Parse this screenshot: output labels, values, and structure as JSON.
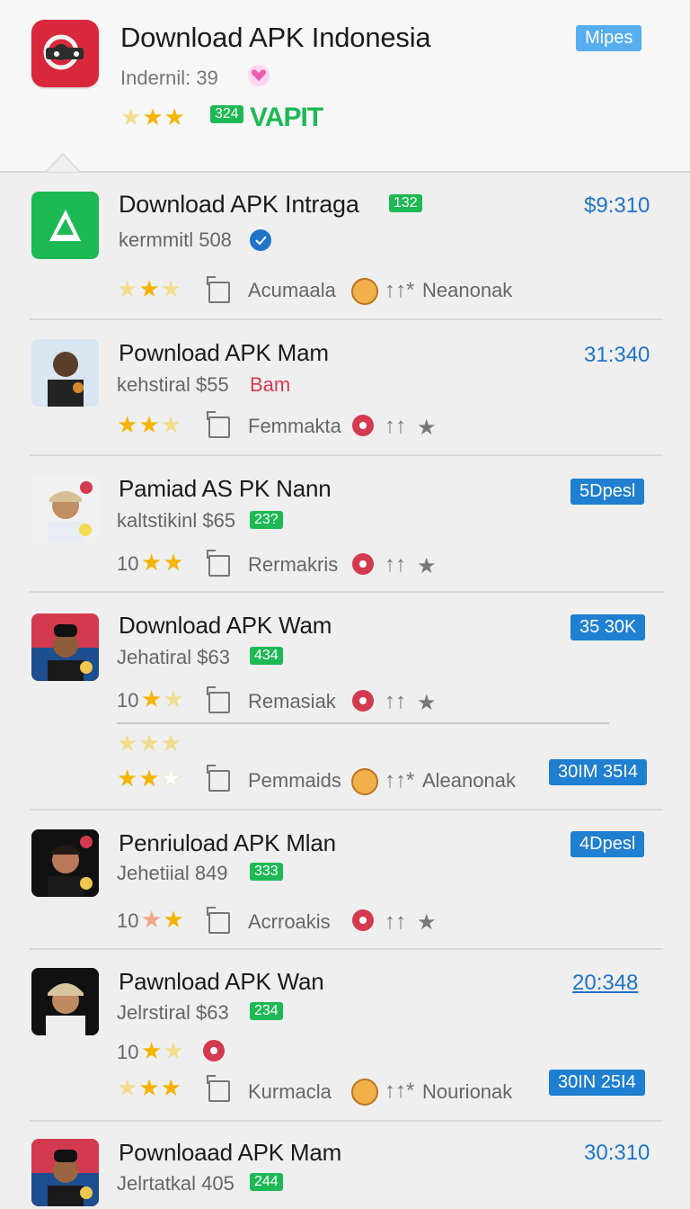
{
  "header": {
    "title": "Download APK Indonesia",
    "subtitle": "Indernil: 39",
    "button": "Mipes",
    "badge": "324",
    "tag": "VAPIT"
  },
  "items": [
    {
      "title": "Download APK Intraga",
      "title_badge": "132",
      "meta": "kermmitl 508",
      "time": "$9:310",
      "footer_left": "Acumaala",
      "footer_right": "Neanonak"
    },
    {
      "title": "Pownload APK Mam",
      "meta": "kehstiral $55",
      "meta_red": "Bam",
      "time": "31:340",
      "footer_left": "Femmakta"
    },
    {
      "title": "Pamiad AS PK Nann",
      "meta": "kaltstikinl $65",
      "meta_badge": "23?",
      "tag": "5Dpesl",
      "footer_prefix": "10",
      "footer_left": "Rermakris"
    },
    {
      "title": "Download APK Wam",
      "meta": "Jehatiral $63",
      "meta_badge": "434",
      "tag": "35 30K",
      "footer_prefix": "10",
      "footer_left": "Remasiak",
      "extra_left": "Pemmaids",
      "extra_right": "Aleanonak",
      "extra_tag": "30IM 35I4"
    },
    {
      "title": "Penriuload APK Mlan",
      "meta": "Jehetiial 849",
      "meta_badge": "333",
      "tag": "4Dpesl",
      "footer_prefix": "10",
      "footer_left": "Acrroakis"
    },
    {
      "title": "Pawnload APK Wan",
      "meta": "Jelrstiral $63",
      "meta_badge": "234",
      "time": "20:348",
      "footer_prefix": "10",
      "footer_left": "Kurmacla",
      "footer_right": "Nourionak",
      "extra_tag": "30IN 25I4"
    },
    {
      "title": "Pownloaad APK Mam",
      "meta": "Jelrtatkal 405",
      "meta_badge": "244",
      "time": "30:310"
    }
  ]
}
